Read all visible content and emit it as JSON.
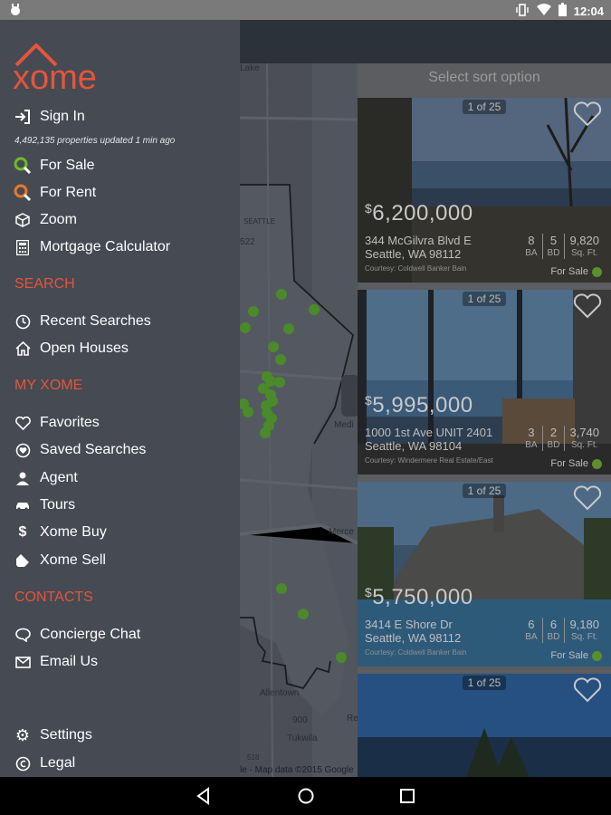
{
  "status_bar": {
    "time": "12:04"
  },
  "sort": {
    "placeholder": "Select sort option"
  },
  "map": {
    "labels": [
      "Lake",
      "SEATTLE",
      "522",
      "Medi",
      "Merce",
      "900",
      "Allentown",
      "Tukwila",
      "Re",
      "518"
    ],
    "attribution": "le - Map data ©2015 Google"
  },
  "listings": [
    {
      "counter": "1 of 25",
      "currency": "$",
      "price": "6,200,000",
      "address1": "344 McGilvra Blvd E",
      "address2": "Seattle, WA 98112",
      "beds": "8",
      "baths": "5",
      "sqft": "9,820",
      "courtesy": "Courtesy: Coldwell Banker Bain",
      "status": "For Sale"
    },
    {
      "counter": "1 of 25",
      "currency": "$",
      "price": "5,995,000",
      "address1": "1000 1st Ave UNIT 2401",
      "address2": "Seattle, WA 98104",
      "beds": "3",
      "baths": "2",
      "sqft": "3,740",
      "courtesy": "Courtesy: Windermere Real Estate/East",
      "status": "For Sale"
    },
    {
      "counter": "1 of 25",
      "currency": "$",
      "price": "5,750,000",
      "address1": "3414 E Shore Dr",
      "address2": "Seattle, WA 98112",
      "beds": "6",
      "baths": "6",
      "sqft": "9,180",
      "courtesy": "Courtesy: Coldwell Banker Bain",
      "status": "For Sale"
    },
    {
      "counter": "1 of 25"
    }
  ],
  "units": {
    "ba": "BA",
    "bd": "BD",
    "sqft": "Sq. Ft."
  },
  "drawer": {
    "logo_text": "xome",
    "sign_in": "Sign In",
    "updated": "4,492,135 properties updated  1 min ago",
    "for_sale": "For Sale",
    "for_rent": "For Rent",
    "zoom": "Zoom",
    "mortgage": "Mortgage Calculator",
    "section_search": "SEARCH",
    "recent_searches": "Recent Searches",
    "open_houses": "Open Houses",
    "section_my": "MY XOME",
    "favorites": "Favorites",
    "saved_searches": "Saved Searches",
    "agent": "Agent",
    "tours": "Tours",
    "xome_buy": "Xome Buy",
    "xome_sell": "Xome Sell",
    "section_contacts": "CONTACTS",
    "concierge_chat": "Concierge Chat",
    "email_us": "Email Us",
    "settings": "Settings",
    "legal": "Legal"
  },
  "colors": {
    "brand": "#e5553b",
    "drawer_bg": "#454a53",
    "sale_dot": "#5b8e2c"
  }
}
